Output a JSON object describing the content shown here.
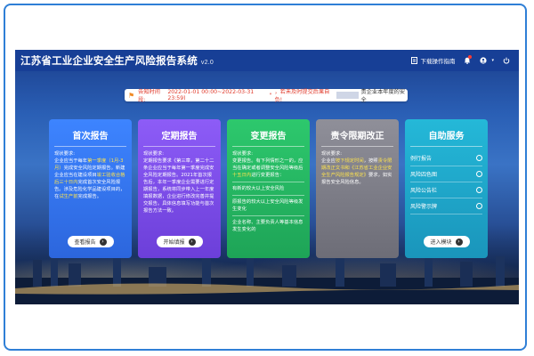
{
  "header": {
    "title": "江苏省工业企业安全生产风险报告系统",
    "version": "v2.0",
    "download_label": "下载操作指南",
    "user_name": ""
  },
  "notice": {
    "label": "告知时间段:",
    "period": "2022-01-01 00:00~2022-03-31 23:59)",
    "quote": "\"",
    "text1": "，若未及时提交后果自负!",
    "text2": "贵企业本年度的安全"
  },
  "cards": [
    {
      "title": "首次报告",
      "lines": [
        {
          "t": "现状要求:",
          "h": false
        },
        {
          "t": "企业应当于每年",
          "h": false
        },
        {
          "t": "第一季度（1月-3月）",
          "h": true
        },
        {
          "t": "完成安全风险定期报告。新建企业应当在建设项目",
          "h": false
        },
        {
          "t": "竣工验收合格后三十日内",
          "h": true
        },
        {
          "t": "完成首次安全风险报告。涉及危险化学品建设项目的，在",
          "h": false
        },
        {
          "t": "试生产前",
          "h": true
        },
        {
          "t": "完成报告。",
          "h": false
        }
      ],
      "button": "查看报告"
    },
    {
      "title": "定期报告",
      "lines": [
        {
          "t": "现状要求:",
          "h": false
        },
        {
          "t": "定期报告要求《第三章，第二十二条企业应当于每年第一季度完成安全风险定期报告。",
          "h": false
        },
        {
          "t": "2021年首次报告后，本年一季度企业需要进行定期报告，系统将同步带入上一年度填报数据，企业进行修改完善并提交报告。具体信息填写功能与首次报告方法一致。",
          "h": false
        }
      ],
      "button": "开始填报"
    },
    {
      "title": "变更报告",
      "lines": [
        {
          "t": "现状要求:",
          "h": false
        },
        {
          "t": "变更报告。有下列情形之一的，应当在确定或者调整安全风险等级后",
          "h": false
        },
        {
          "t": "十五日内",
          "h": true
        },
        {
          "t": "进行变更报告：",
          "h": false
        }
      ],
      "items": [
        "有新的较大以上安全风险",
        "原报告的较大以上安全风险等级发生变化",
        "企业名称、主要负责人等基本信息发生变化的"
      ],
      "button": ""
    },
    {
      "title": "责令限期改正",
      "lines": [
        {
          "t": "现状要求:",
          "h": false
        },
        {
          "t": "企业应",
          "h": false
        },
        {
          "t": "按下规定时间",
          "h": true
        },
        {
          "t": "，按照",
          "h": false
        },
        {
          "t": "责令限期改正文书和《江苏省工业企业安全生产风险报告规定》",
          "h": true
        },
        {
          "t": "要求，如实报告安全风险信息。",
          "h": false
        }
      ],
      "button": ""
    },
    {
      "title": "自助服务",
      "services": [
        "例行报告",
        "风险四色图",
        "风险公告栏",
        "风险警示牌"
      ],
      "button": "进入模块"
    }
  ],
  "colors": {
    "accent": "#2f7fd6",
    "highlight": "#ffe44d",
    "topbar": "#173f96"
  }
}
